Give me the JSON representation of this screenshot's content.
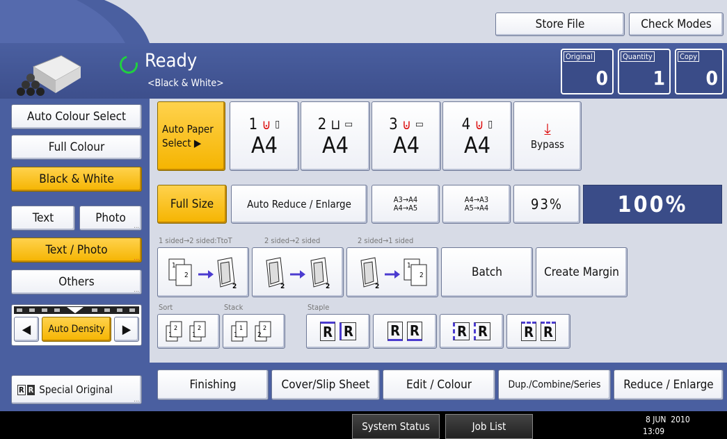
{
  "top": {
    "store_file": "Store File",
    "check_modes": "Check Modes"
  },
  "status": {
    "ready": "Ready",
    "mode": "<Black & White>"
  },
  "counters": [
    {
      "label": "Original",
      "value": "0"
    },
    {
      "label": "Quantity",
      "value": "1"
    },
    {
      "label": "Copy",
      "value": "0"
    }
  ],
  "colour": {
    "auto": "Auto Colour Select",
    "full": "Full Colour",
    "bw": "Black & White"
  },
  "original_type": {
    "text": "Text",
    "photo": "Photo",
    "text_photo": "Text / Photo",
    "others": "Others"
  },
  "density": {
    "label": "Auto Density"
  },
  "special_original": {
    "label": "Special Original"
  },
  "paper": {
    "auto_line1": "Auto Paper",
    "auto_line2": "Select",
    "trays": [
      {
        "num": "1",
        "size": "A4"
      },
      {
        "num": "2",
        "size": "A4"
      },
      {
        "num": "3",
        "size": "A4"
      },
      {
        "num": "4",
        "size": "A4"
      }
    ],
    "bypass": "Bypass"
  },
  "reduce": {
    "full_size": "Full Size",
    "auto_re": "Auto Reduce / Enlarge",
    "p1_a": "A3→A4",
    "p1_b": "A4→A5",
    "p2_a": "A4→A3",
    "p2_b": "A5→A4",
    "pct93": "93%",
    "current": "100%"
  },
  "duplex": {
    "label1": "1 sided→2 sided:TtoT",
    "label2": "2 sided→2 sided",
    "label3": "2 sided→1 sided",
    "batch": "Batch",
    "margin": "Create Margin"
  },
  "finish": {
    "sort": "Sort",
    "stack": "Stack",
    "staple": "Staple"
  },
  "tabs": {
    "finishing": "Finishing",
    "cover": "Cover/Slip Sheet",
    "edit": "Edit / Colour",
    "dup": "Dup./Combine/Series",
    "reduce": "Reduce / Enlarge"
  },
  "bottom": {
    "system_status": "System Status",
    "job_list": "Job List",
    "date": "8 JUN  2010",
    "time": "13:09"
  }
}
